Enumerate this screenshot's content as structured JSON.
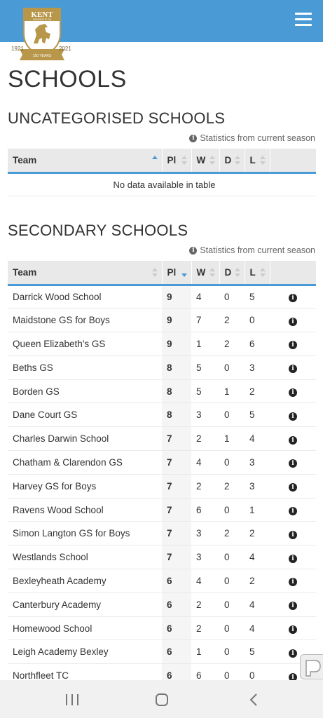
{
  "header": {
    "logo_alt": "Kent Schools' FA",
    "logo_name": "KENT",
    "logo_sub": "SCHOOLS' FA",
    "logo_year_start": "1921",
    "logo_year_end": "2021",
    "logo_banner": "100 YEARS",
    "menu_icon": "hamburger-menu-icon"
  },
  "page_title": "SCHOOLS",
  "uncategorised": {
    "title": "UNCATEGORISED SCHOOLS",
    "stats_note": "Statistics from current season",
    "columns": [
      "Team",
      "Pl",
      "W",
      "D",
      "L"
    ],
    "empty_message": "No data available in table"
  },
  "secondary": {
    "title": "SECONDARY SCHOOLS",
    "stats_note": "Statistics from current season",
    "columns": [
      "Team",
      "Pl",
      "W",
      "D",
      "L"
    ],
    "rows": [
      {
        "team": "Darrick Wood School",
        "pl": "9",
        "w": "4",
        "d": "0",
        "l": "5"
      },
      {
        "team": "Maidstone GS for Boys",
        "pl": "9",
        "w": "7",
        "d": "2",
        "l": "0"
      },
      {
        "team": "Queen Elizabeth's GS",
        "pl": "9",
        "w": "1",
        "d": "2",
        "l": "6"
      },
      {
        "team": "Beths GS",
        "pl": "8",
        "w": "5",
        "d": "0",
        "l": "3"
      },
      {
        "team": "Borden GS",
        "pl": "8",
        "w": "5",
        "d": "1",
        "l": "2"
      },
      {
        "team": "Dane Court GS",
        "pl": "8",
        "w": "3",
        "d": "0",
        "l": "5"
      },
      {
        "team": "Charles Darwin School",
        "pl": "7",
        "w": "2",
        "d": "1",
        "l": "4"
      },
      {
        "team": "Chatham & Clarendon GS",
        "pl": "7",
        "w": "4",
        "d": "0",
        "l": "3"
      },
      {
        "team": "Harvey GS for Boys",
        "pl": "7",
        "w": "2",
        "d": "2",
        "l": "3"
      },
      {
        "team": "Ravens Wood School",
        "pl": "7",
        "w": "6",
        "d": "0",
        "l": "1"
      },
      {
        "team": "Simon Langton GS for Boys",
        "pl": "7",
        "w": "3",
        "d": "2",
        "l": "2"
      },
      {
        "team": "Westlands School",
        "pl": "7",
        "w": "3",
        "d": "0",
        "l": "4"
      },
      {
        "team": "Bexleyheath Academy",
        "pl": "6",
        "w": "4",
        "d": "0",
        "l": "2"
      },
      {
        "team": "Canterbury Academy",
        "pl": "6",
        "w": "2",
        "d": "0",
        "l": "4"
      },
      {
        "team": "Homewood School",
        "pl": "6",
        "w": "2",
        "d": "0",
        "l": "4"
      },
      {
        "team": "Leigh Academy Bexley",
        "pl": "6",
        "w": "1",
        "d": "0",
        "l": "5"
      },
      {
        "team": "Northfleet TC",
        "pl": "6",
        "w": "6",
        "d": "0",
        "l": "0"
      }
    ]
  },
  "colors": {
    "header_blue": "#4a9ad6",
    "table_header_bg": "#e9e9e9",
    "logo_gold": "#b8964a"
  },
  "nav": {
    "recents_icon": "recents-icon",
    "home_icon": "home-icon",
    "back_icon": "back-icon"
  }
}
